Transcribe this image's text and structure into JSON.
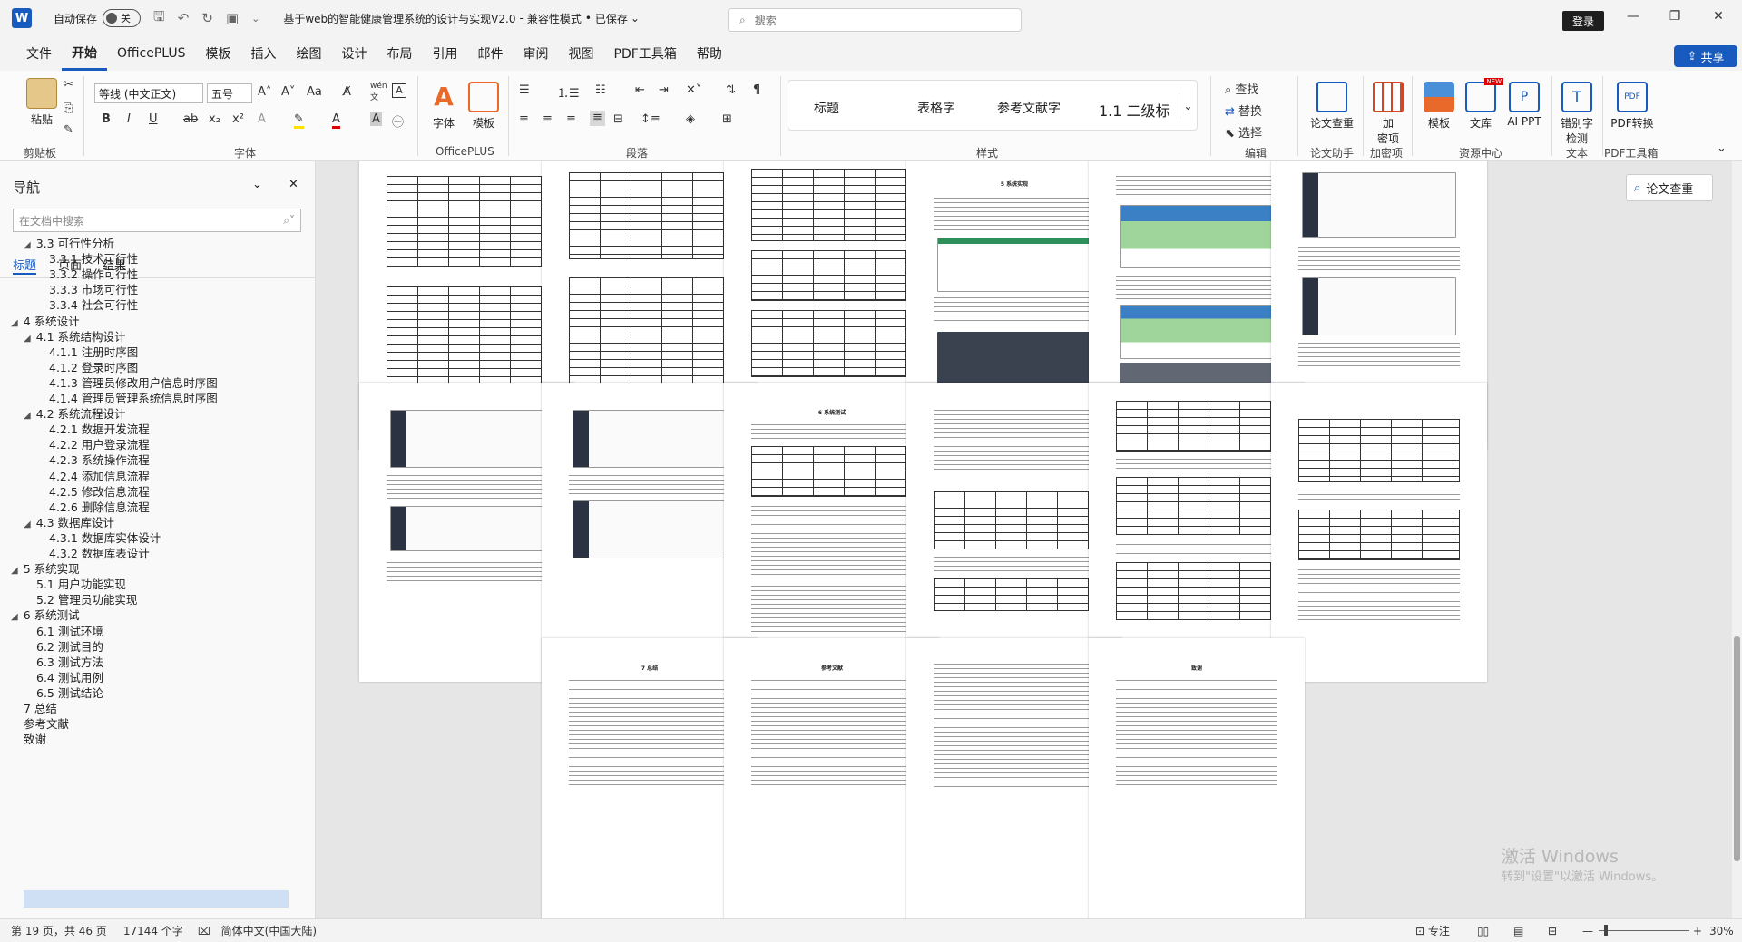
{
  "titlebar": {
    "autosave_label": "自动保存",
    "autosave_state": "关",
    "doc_title": "基于web的智能健康管理系统的设计与实现V2.0",
    "mode": "兼容性模式",
    "saved": "已保存",
    "search_placeholder": "搜索",
    "login_label": "登录"
  },
  "menu": {
    "items": [
      "文件",
      "开始",
      "OfficePLUS",
      "模板",
      "插入",
      "绘图",
      "设计",
      "布局",
      "引用",
      "邮件",
      "审阅",
      "视图",
      "PDF工具箱",
      "帮助"
    ],
    "active": "开始",
    "share_label": "共享"
  },
  "ribbon": {
    "paste_label": "粘贴",
    "clipboard_label": "剪贴板",
    "font_name": "等线 (中文正文)",
    "font_size": "五号",
    "font_group_label": "字体",
    "officeplus_group_label": "OfficePLUS",
    "font_btn_label": "字体",
    "template_btn_label": "模板",
    "paragraph_label": "段落",
    "styles": [
      "标题",
      "表格字",
      "参考文献字",
      "1.1 二级标"
    ],
    "styles_label": "样式",
    "find_label": "查找",
    "replace_label": "替换",
    "select_label": "选择",
    "edit_label": "编辑",
    "thesis_check_label": "论文查重",
    "thesis_assist_label": "论文助手",
    "encrypt_label": "加密项",
    "encrypt_btn": "加",
    "encrypt_btn2": "密项",
    "template_label": "模板",
    "library_label": "文库",
    "ai_ppt_label": "AI PPT",
    "resource_center_label": "资源中心",
    "typo_check_label": "错别字检测",
    "typo_1": "错别字",
    "typo_2": "检测",
    "text_label": "文本",
    "pdf_convert_label": "PDF转换",
    "pdf_tools_label": "PDF工具箱",
    "new_badge": "NEW"
  },
  "nav": {
    "title": "导航",
    "search_placeholder": "在文档中搜索",
    "tabs": [
      "标题",
      "页面",
      "结果"
    ],
    "items": [
      {
        "level": 2,
        "text": "3.3 可行性分析",
        "caret": "◢"
      },
      {
        "level": 3,
        "text": "3.3.1 技术可行性"
      },
      {
        "level": 3,
        "text": "3.3.2 操作可行性"
      },
      {
        "level": 3,
        "text": "3.3.3 市场可行性"
      },
      {
        "level": 3,
        "text": "3.3.4 社会可行性"
      },
      {
        "level": 1,
        "text": "4 系统设计",
        "caret": "◢"
      },
      {
        "level": 2,
        "text": "4.1 系统结构设计",
        "caret": "◢"
      },
      {
        "level": 3,
        "text": "4.1.1 注册时序图"
      },
      {
        "level": 3,
        "text": "4.1.2 登录时序图"
      },
      {
        "level": 3,
        "text": "4.1.3 管理员修改用户信息时序图"
      },
      {
        "level": 3,
        "text": "4.1.4 管理员管理系统信息时序图"
      },
      {
        "level": 2,
        "text": "4.2 系统流程设计",
        "caret": "◢"
      },
      {
        "level": 3,
        "text": "4.2.1 数据开发流程"
      },
      {
        "level": 3,
        "text": "4.2.2 用户登录流程"
      },
      {
        "level": 3,
        "text": "4.2.3 系统操作流程"
      },
      {
        "level": 3,
        "text": "4.2.4 添加信息流程"
      },
      {
        "level": 3,
        "text": "4.2.5 修改信息流程"
      },
      {
        "level": 3,
        "text": "4.2.6 删除信息流程"
      },
      {
        "level": 2,
        "text": "4.3 数据库设计",
        "caret": "◢"
      },
      {
        "level": 3,
        "text": "4.3.1 数据库实体设计"
      },
      {
        "level": 3,
        "text": "4.3.2 数据库表设计"
      },
      {
        "level": 1,
        "text": "5 系统实现",
        "caret": "◢"
      },
      {
        "level": 2,
        "text": "5.1 用户功能实现"
      },
      {
        "level": 2,
        "text": "5.2 管理员功能实现"
      },
      {
        "level": 1,
        "text": "6 系统测试",
        "caret": "◢"
      },
      {
        "level": 2,
        "text": "6.1 测试环境"
      },
      {
        "level": 2,
        "text": "6.2 测试目的"
      },
      {
        "level": 2,
        "text": "6.3 测试方法"
      },
      {
        "level": 2,
        "text": "6.4 测试用例"
      },
      {
        "level": 2,
        "text": "6.5 测试结论"
      },
      {
        "level": 1,
        "text": "7 总结"
      },
      {
        "level": 1,
        "text": "参考文献"
      },
      {
        "level": 1,
        "text": "致谢"
      }
    ],
    "selected": "致谢"
  },
  "pages": {
    "system_impl_title": "5 系统实现",
    "system_test_title": "6 系统测试",
    "summary_title": "7 总结",
    "references_title": "参考文献",
    "thanks_title": "致谢"
  },
  "side": {
    "thesis_check_button": "论文查重"
  },
  "watermark": {
    "line1": "激活 Windows",
    "line2": "转到\"设置\"以激活 Windows。"
  },
  "status": {
    "page": "第 19 页，共 46 页",
    "words": "17144 个字",
    "language": "简体中文(中国大陆)",
    "focus": "专注",
    "zoom": "30%"
  }
}
